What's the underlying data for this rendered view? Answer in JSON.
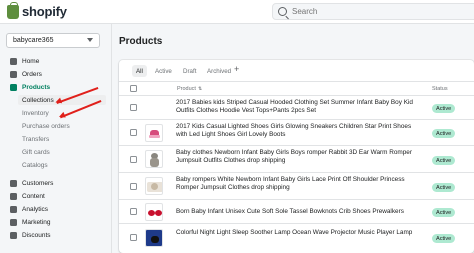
{
  "app": {
    "logo_text": "shopify",
    "logo_icon": "shopify-bag-icon"
  },
  "search": {
    "placeholder": "Search"
  },
  "store": {
    "name": "babycare365"
  },
  "sidebar": {
    "items": [
      {
        "label": "Home",
        "icon": "home-icon"
      },
      {
        "label": "Orders",
        "icon": "orders-icon"
      },
      {
        "label": "Products",
        "icon": "tag-icon",
        "active": true
      },
      {
        "label": "Customers",
        "icon": "person-icon"
      },
      {
        "label": "Content",
        "icon": "content-icon"
      },
      {
        "label": "Analytics",
        "icon": "analytics-icon"
      },
      {
        "label": "Marketing",
        "icon": "marketing-icon"
      },
      {
        "label": "Discounts",
        "icon": "discount-icon"
      }
    ],
    "subitems": [
      "Collections",
      "Inventory",
      "Purchase orders",
      "Transfers",
      "Gift cards",
      "Catalogs"
    ]
  },
  "page": {
    "title": "Products"
  },
  "tabs": [
    "All",
    "Active",
    "Draft",
    "Archived"
  ],
  "table": {
    "headers": {
      "product": "Product",
      "status": "Status"
    },
    "rows": [
      {
        "name": "2017 Babies kids Striped Casual Hooded Clothing Set Summer Infant Baby Boy Kid Outfits Clothes Hoodie Vest Tops+Pants 2pcs Set",
        "status": "Active",
        "has_image": false
      },
      {
        "name": "2017 Kids Casual Lighted Shoes Girls Glowing Sneakers Children Star Print Shoes with Led Light Shoes Girl Lovely Boots",
        "status": "Active",
        "has_image": true
      },
      {
        "name": "Baby clothes Newborn Infant Baby Girls Boys romper Rabbit 3D Ear Warm Romper Jumpsuit Outfits Clothes drop shipping",
        "status": "Active",
        "has_image": true
      },
      {
        "name": "Baby rompers White Newborn Infant Baby Girls Lace Print Off Shoulder Princess Romper Jumpsuit Clothes drop shipping",
        "status": "Active",
        "has_image": true
      },
      {
        "name": "Born Baby Infant Unisex Cute Soft Sole Tassel Bowknots Crib Shoes Prewalkers",
        "status": "Active",
        "has_image": true
      },
      {
        "name": "Colorful Night Light Sleep Soother Lamp Ocean Wave Projector Music Player Lamp",
        "status": "Active",
        "has_image": true
      }
    ]
  },
  "colors": {
    "accent": "#008060",
    "arrow": "#e0201b",
    "badge_bg": "#aee9d1"
  }
}
